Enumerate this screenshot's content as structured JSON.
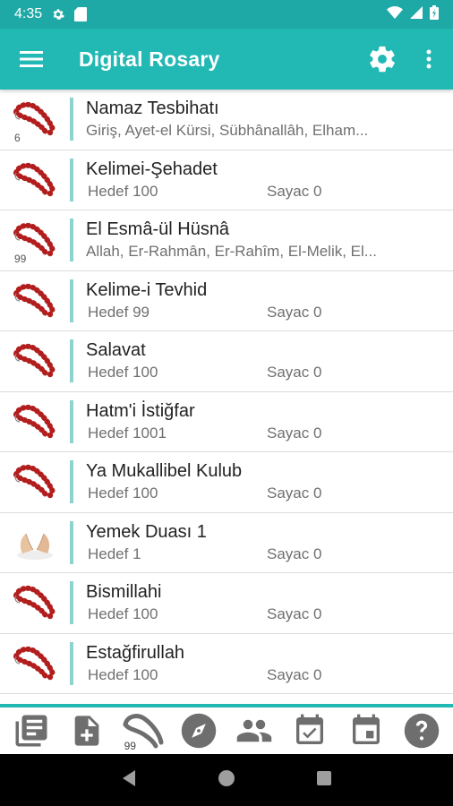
{
  "status_bar": {
    "time": "4:35",
    "icons": [
      "settings-icon",
      "sd-card-icon",
      "wifi-icon",
      "signal-icon",
      "battery-icon"
    ]
  },
  "app_bar": {
    "title": "Digital Rosary",
    "left_icon": "menu-icon",
    "right_icons": [
      "settings-icon",
      "more-vert-icon"
    ]
  },
  "colors": {
    "status_bar": "#1fa9a6",
    "app_bar": "#22b8b4",
    "row_divider": "#8fd3d0",
    "rosary_bead": "#b21e1e",
    "toolbar_icon": "#6e6e6e"
  },
  "list": {
    "items": [
      {
        "name": "Namaz Tesbihatı",
        "subtitle": "Giriş, Ayet-el Kürsi, Sübhânallâh, Elham...",
        "badge": "6",
        "thumb": "rosary-icon"
      },
      {
        "name": "Kelimei-Şehadet",
        "hedef": "Hedef 100",
        "sayac": "Sayac 0",
        "thumb": "rosary-icon"
      },
      {
        "name": "El Esmâ-ül Hüsnâ",
        "subtitle": "Allah, Er-Rahmân, Er-Rahîm, El-Melik, El...",
        "badge": "99",
        "thumb": "rosary-icon"
      },
      {
        "name": "Kelime-i Tevhid",
        "hedef": "Hedef 99",
        "sayac": "Sayac 0",
        "thumb": "rosary-icon"
      },
      {
        "name": "Salavat",
        "hedef": "Hedef 100",
        "sayac": "Sayac 0",
        "thumb": "rosary-icon"
      },
      {
        "name": "Hatm'i İstiğfar",
        "hedef": "Hedef 1001",
        "sayac": "Sayac 0",
        "thumb": "rosary-icon"
      },
      {
        "name": "Ya Mukallibel Kulub",
        "hedef": "Hedef 100",
        "sayac": "Sayac 0",
        "thumb": "rosary-icon"
      },
      {
        "name": "Yemek Duası 1",
        "hedef": "Hedef 1",
        "sayac": "Sayac 0",
        "thumb": "praying-hands-icon"
      },
      {
        "name": "Bismillahi",
        "hedef": "Hedef 100",
        "sayac": "Sayac 0",
        "thumb": "rosary-icon"
      },
      {
        "name": "Estağfirullah",
        "hedef": "Hedef 100",
        "sayac": "Sayac 0",
        "thumb": "rosary-icon"
      }
    ]
  },
  "toolbar": {
    "buttons": [
      {
        "icon": "library-books-icon"
      },
      {
        "icon": "note-add-icon"
      },
      {
        "icon": "rosary-outline-icon",
        "badge": "99"
      },
      {
        "icon": "compass-icon"
      },
      {
        "icon": "people-icon"
      },
      {
        "icon": "calendar-check-icon"
      },
      {
        "icon": "calendar-event-icon"
      },
      {
        "icon": "help-icon"
      }
    ]
  },
  "nav_bar": {
    "buttons": [
      "back-icon",
      "home-icon",
      "recents-icon"
    ]
  }
}
